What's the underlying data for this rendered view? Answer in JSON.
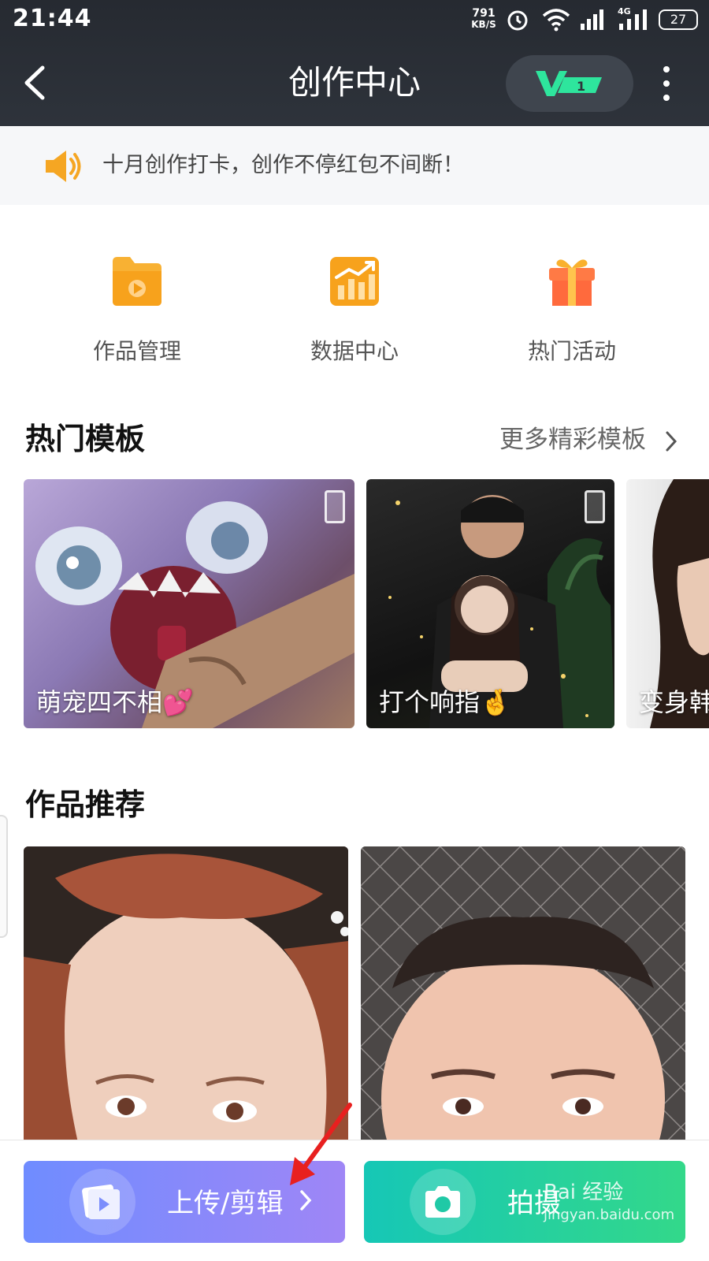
{
  "status_bar": {
    "time": "21:44",
    "net_speed_value": "791",
    "net_speed_unit": "KB/S",
    "network_type": "4G",
    "battery": "27"
  },
  "header": {
    "title": "创作中心",
    "vip_badge": "V1"
  },
  "notice": {
    "text": "十月创作打卡，创作不停红包不间断！"
  },
  "actions": [
    {
      "label": "作品管理",
      "icon": "folder-play-icon"
    },
    {
      "label": "数据中心",
      "icon": "chart-icon"
    },
    {
      "label": "热门活动",
      "icon": "gift-icon"
    }
  ],
  "templates_section": {
    "title": "热门模板",
    "more_label": "更多精彩模板",
    "items": [
      {
        "caption": "萌宠四不相💕"
      },
      {
        "caption": "打个响指🤞"
      },
      {
        "caption": "变身韩"
      }
    ]
  },
  "recommend_section": {
    "title": "作品推荐"
  },
  "bottom_bar": {
    "upload_label": "上传/剪辑",
    "shoot_label": "拍摄"
  },
  "watermark": {
    "text": "Bai 经验",
    "url": "jingyan.baidu.com"
  },
  "colors": {
    "header_bg": "#2a2e35",
    "accent_orange": "#f5a623",
    "vip_green": "#2ee59d",
    "upload_gradient": [
      "#6f8cff",
      "#9f86f6"
    ],
    "shoot_gradient": [
      "#16c7b6",
      "#33d88a"
    ]
  }
}
